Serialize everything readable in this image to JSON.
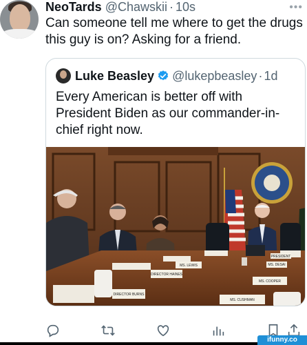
{
  "tweet": {
    "author_name": "NeoTards",
    "author_handle": "@Chawskii",
    "separator": "·",
    "time": "10s",
    "text": "Can someone tell me where to get the drugs this guy is on? Asking for a friend."
  },
  "quote": {
    "author_name": "Luke Beasley",
    "author_handle": "@lukepbeasley",
    "separator": "·",
    "time": "1d",
    "text": "Every American is better off with President Biden as our commander-in-chief right now."
  },
  "photo_placards": [
    "DIRECTOR BURNS",
    "DIRECTOR HAINES",
    "MS. LEWIS",
    "PRESIDENT",
    "MS. COOPER",
    "MS. DESAI",
    "MS. CUSHMAN"
  ],
  "watermark": "ifunny.co",
  "colors": {
    "text": "#0f1419",
    "secondary": "#536471",
    "border": "#cfd9de",
    "verified": "#1d9bf0"
  },
  "icons": [
    "reply-icon",
    "retweet-icon",
    "like-icon",
    "views-icon",
    "bookmark-icon",
    "share-icon"
  ]
}
